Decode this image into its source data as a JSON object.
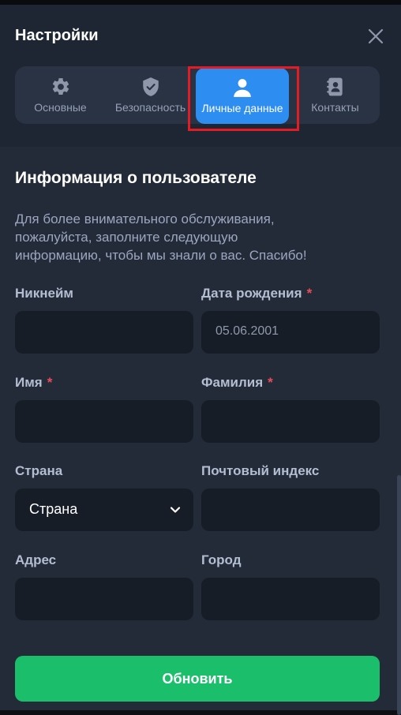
{
  "header": {
    "title": "Настройки"
  },
  "tabs": [
    {
      "label": "Основные",
      "icon": "gear-icon"
    },
    {
      "label": "Безопасность",
      "icon": "shield-check-icon"
    },
    {
      "label": "Личные данные",
      "icon": "person-icon",
      "active": true
    },
    {
      "label": "Контакты",
      "icon": "contact-book-icon"
    }
  ],
  "section": {
    "title": "Информация о пользователе",
    "description_lines": [
      "Для более внимательного обслуживания,",
      "пожалуйста, заполните следующую",
      "информацию, чтобы мы знали о вас. Спасибо!"
    ]
  },
  "form": {
    "nickname": {
      "label": "Никнейм",
      "value": ""
    },
    "birthdate": {
      "label": "Дата рождения",
      "required_mark": "*",
      "value": "05.06.2001"
    },
    "first_name": {
      "label": "Имя",
      "required_mark": "*",
      "value": ""
    },
    "last_name": {
      "label": "Фамилия",
      "required_mark": "*",
      "value": ""
    },
    "country": {
      "label": "Страна",
      "selected": "Страна"
    },
    "postal_code": {
      "label": "Почтовый индекс",
      "value": ""
    },
    "address": {
      "label": "Адрес",
      "value": ""
    },
    "city": {
      "label": "Город",
      "value": ""
    }
  },
  "submit_label": "Обновить",
  "colors": {
    "accent": "#2d8df0",
    "submit": "#1bbf6b",
    "required": "#ec4a5b",
    "highlight": "#e51b23"
  }
}
